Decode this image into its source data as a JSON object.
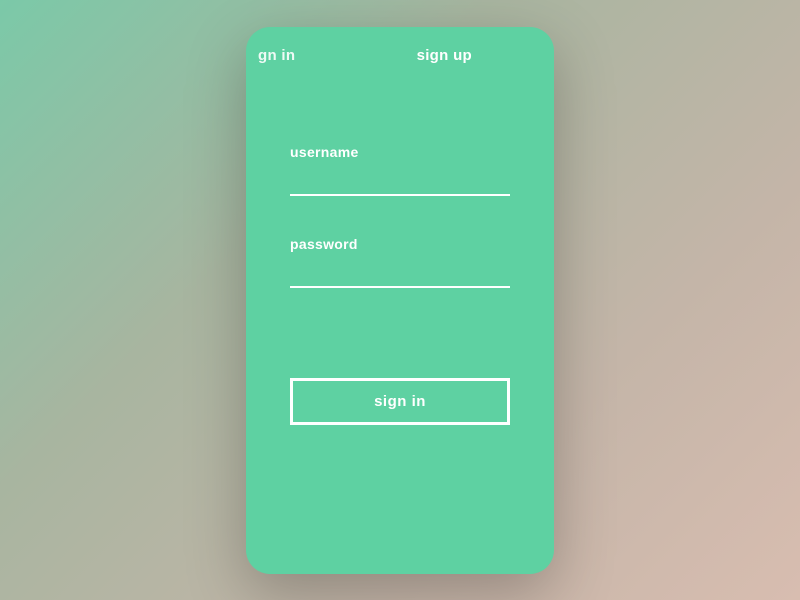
{
  "tabs": {
    "signin": "gn in",
    "signup": "sign up"
  },
  "form": {
    "username_label": "username",
    "username_value": "",
    "password_label": "password",
    "password_value": ""
  },
  "button": {
    "submit_label": "sign in"
  },
  "colors": {
    "card_bg": "#5ed1a2",
    "text": "#ffffff"
  }
}
